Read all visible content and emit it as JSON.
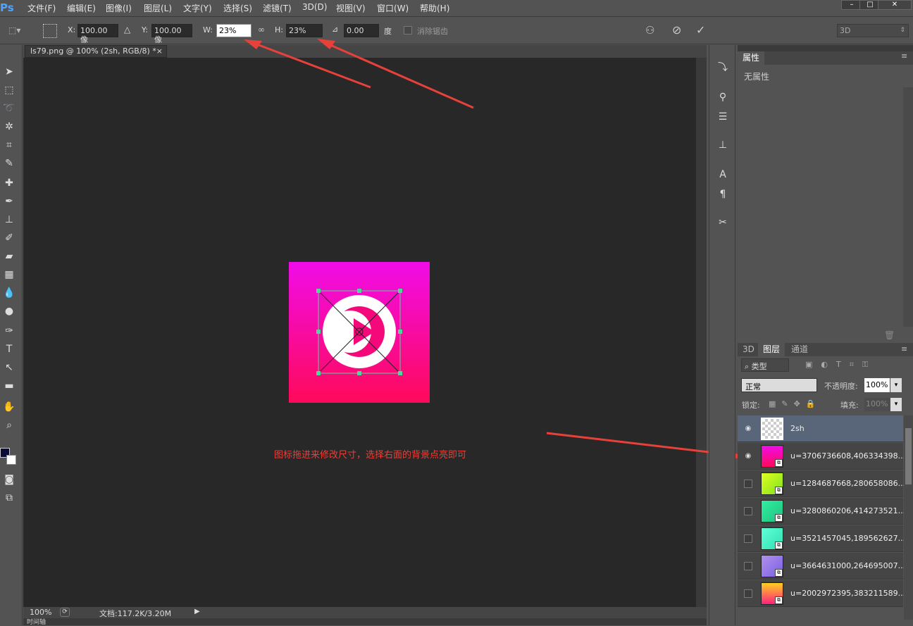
{
  "app": {
    "logo": "Ps"
  },
  "menu": [
    "文件(F)",
    "编辑(E)",
    "图像(I)",
    "图层(L)",
    "文字(Y)",
    "选择(S)",
    "滤镜(T)",
    "3D(D)",
    "视图(V)",
    "窗口(W)",
    "帮助(H)"
  ],
  "window_controls": {
    "minimize": "–",
    "maximize": "□",
    "close": "✕"
  },
  "options": {
    "x_label": "X:",
    "x_value": "100.00 像",
    "y_label": "Y:",
    "y_value": "100.00 像",
    "w_label": "W:",
    "w_value": "23%",
    "h_label": "H:",
    "h_value": "23%",
    "angle_value": "0.00",
    "angle_unit": "度",
    "antialias_label": "消除锯齿",
    "workspace": "3D"
  },
  "document": {
    "tab_title": "ls79.png @ 100% (2sh, RGB/8) *",
    "tab_close": "×",
    "zoom": "100%",
    "doc_info": "文档:117.2K/3.20M",
    "bottom_tab": "时间轴"
  },
  "annotation": {
    "text": "图标拖进来修改尺寸，选择右面的背景点亮即可",
    "color": "#e8403a"
  },
  "properties_panel": {
    "tab": "属性",
    "content": "无属性"
  },
  "layers_panel": {
    "tabs": [
      "3D",
      "图层",
      "通道"
    ],
    "active_tab": "图层",
    "filter_kind": "类型",
    "blend_mode": "正常",
    "opacity_label": "不透明度:",
    "opacity_value": "100%",
    "lock_label": "锁定:",
    "fill_label": "填充:",
    "fill_value": "100%",
    "layers": [
      {
        "name": "2sh",
        "visible": true,
        "selected": true,
        "color": "transparent"
      },
      {
        "name": "u=3706736608,406334398...",
        "visible": true,
        "selected": false,
        "color": "#f0148c"
      },
      {
        "name": "u=1284687668,280658086...",
        "visible": false,
        "selected": false,
        "color": "#c0f020"
      },
      {
        "name": "u=3280860206,414273521...",
        "visible": false,
        "selected": false,
        "color": "#20d890"
      },
      {
        "name": "u=3521457045,189562627...",
        "visible": false,
        "selected": false,
        "color": "#40f0c8"
      },
      {
        "name": "u=3664631000,264695007...",
        "visible": false,
        "selected": false,
        "color": "#9a78e8"
      },
      {
        "name": "u=2002972395,383211589...",
        "visible": false,
        "selected": false,
        "color": "#ff7a3a"
      }
    ]
  },
  "icon_art": {
    "gradient_top": "#f00ce8",
    "gradient_bottom": "#ff0a5a"
  }
}
